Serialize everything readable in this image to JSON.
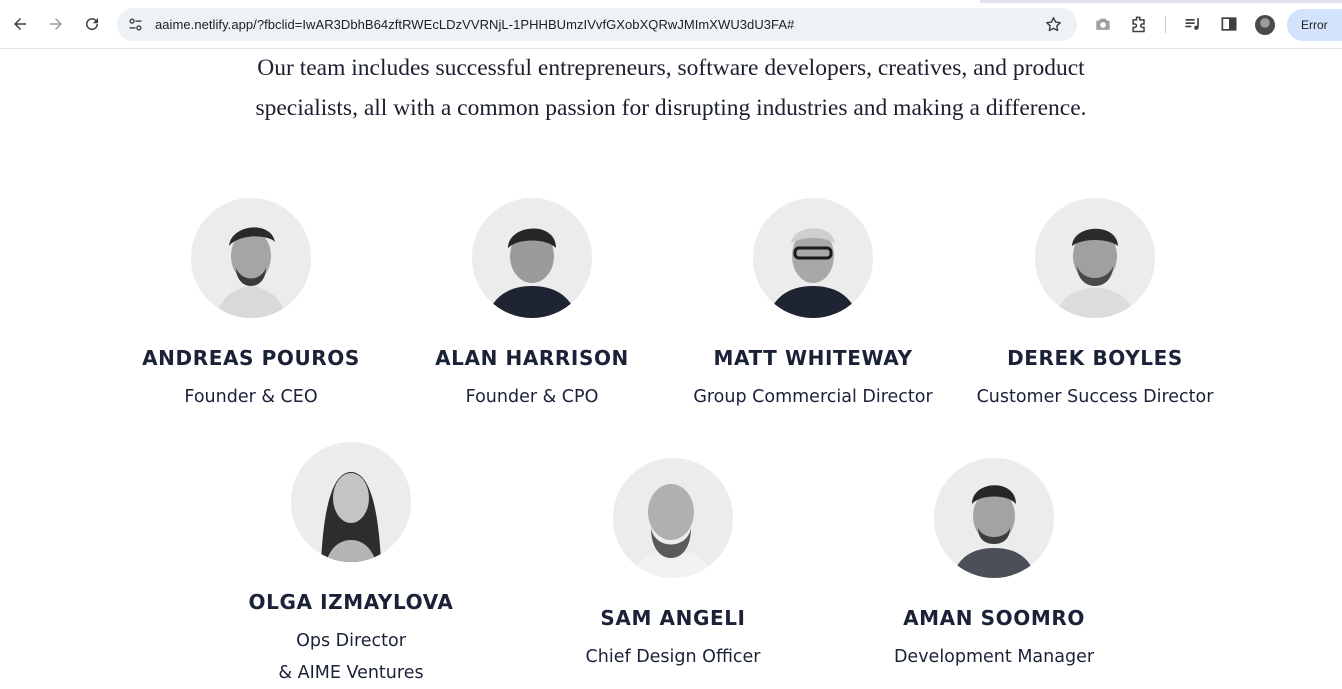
{
  "browser": {
    "url": "aaime.netlify.app/?fbclid=IwAR3DbhB64zftRWEcLDzVVRNjL-1PHHBUmzIVvfGXobXQRwJMImXWU3dU3FA#",
    "profile_button_label": "Error",
    "icons": [
      "back-arrow-icon",
      "forward-arrow-icon",
      "reload-icon",
      "site-info-icon",
      "star-icon",
      "screenshot-icon",
      "extensions-icon",
      "media-controls-icon",
      "side-panel-icon",
      "profile-avatar",
      "more-icon"
    ]
  },
  "intro": {
    "text": "Our team includes successful entrepreneurs, software developers, creatives, and product specialists, all with a common passion for disrupting industries and making a difference."
  },
  "team": {
    "row1": [
      {
        "name": "ANDREAS POUROS",
        "role": "Founder & CEO"
      },
      {
        "name": "ALAN HARRISON",
        "role": "Founder & CPO"
      },
      {
        "name": "MATT WHITEWAY",
        "role": "Group Commercial Director"
      },
      {
        "name": "DEREK BOYLES",
        "role": "Customer Success Director"
      }
    ],
    "row2": [
      {
        "name": "OLGA IZMAYLOVA",
        "role": "Ops Director",
        "role_line2": "& AIME Ventures"
      },
      {
        "name": "SAM ANGELI",
        "role": "Chief Design Officer"
      },
      {
        "name": "AMAN SOOMRO",
        "role": "Development Manager"
      }
    ]
  },
  "colors": {
    "text_dark": "#1b2238",
    "photo_bg": "#ececec",
    "omnibox_bg": "#eef1f6",
    "error_chip_bg": "#d3e3fd"
  }
}
